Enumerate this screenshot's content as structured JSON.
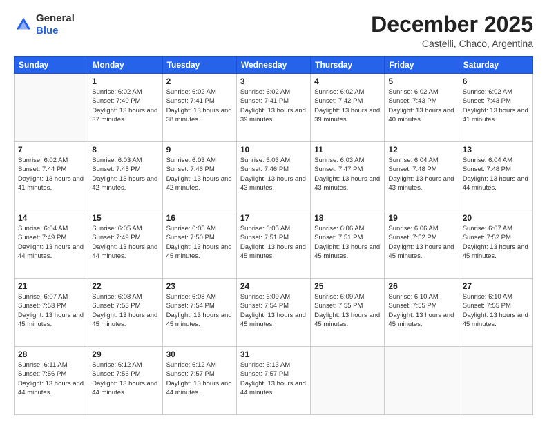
{
  "header": {
    "logo_general": "General",
    "logo_blue": "Blue",
    "month_title": "December 2025",
    "location": "Castelli, Chaco, Argentina"
  },
  "days_of_week": [
    "Sunday",
    "Monday",
    "Tuesday",
    "Wednesday",
    "Thursday",
    "Friday",
    "Saturday"
  ],
  "weeks": [
    [
      {
        "day": "",
        "sunrise": "",
        "sunset": "",
        "daylight": ""
      },
      {
        "day": "1",
        "sunrise": "Sunrise: 6:02 AM",
        "sunset": "Sunset: 7:40 PM",
        "daylight": "Daylight: 13 hours and 37 minutes."
      },
      {
        "day": "2",
        "sunrise": "Sunrise: 6:02 AM",
        "sunset": "Sunset: 7:41 PM",
        "daylight": "Daylight: 13 hours and 38 minutes."
      },
      {
        "day": "3",
        "sunrise": "Sunrise: 6:02 AM",
        "sunset": "Sunset: 7:41 PM",
        "daylight": "Daylight: 13 hours and 39 minutes."
      },
      {
        "day": "4",
        "sunrise": "Sunrise: 6:02 AM",
        "sunset": "Sunset: 7:42 PM",
        "daylight": "Daylight: 13 hours and 39 minutes."
      },
      {
        "day": "5",
        "sunrise": "Sunrise: 6:02 AM",
        "sunset": "Sunset: 7:43 PM",
        "daylight": "Daylight: 13 hours and 40 minutes."
      },
      {
        "day": "6",
        "sunrise": "Sunrise: 6:02 AM",
        "sunset": "Sunset: 7:43 PM",
        "daylight": "Daylight: 13 hours and 41 minutes."
      }
    ],
    [
      {
        "day": "7",
        "sunrise": "Sunrise: 6:02 AM",
        "sunset": "Sunset: 7:44 PM",
        "daylight": "Daylight: 13 hours and 41 minutes."
      },
      {
        "day": "8",
        "sunrise": "Sunrise: 6:03 AM",
        "sunset": "Sunset: 7:45 PM",
        "daylight": "Daylight: 13 hours and 42 minutes."
      },
      {
        "day": "9",
        "sunrise": "Sunrise: 6:03 AM",
        "sunset": "Sunset: 7:46 PM",
        "daylight": "Daylight: 13 hours and 42 minutes."
      },
      {
        "day": "10",
        "sunrise": "Sunrise: 6:03 AM",
        "sunset": "Sunset: 7:46 PM",
        "daylight": "Daylight: 13 hours and 43 minutes."
      },
      {
        "day": "11",
        "sunrise": "Sunrise: 6:03 AM",
        "sunset": "Sunset: 7:47 PM",
        "daylight": "Daylight: 13 hours and 43 minutes."
      },
      {
        "day": "12",
        "sunrise": "Sunrise: 6:04 AM",
        "sunset": "Sunset: 7:48 PM",
        "daylight": "Daylight: 13 hours and 43 minutes."
      },
      {
        "day": "13",
        "sunrise": "Sunrise: 6:04 AM",
        "sunset": "Sunset: 7:48 PM",
        "daylight": "Daylight: 13 hours and 44 minutes."
      }
    ],
    [
      {
        "day": "14",
        "sunrise": "Sunrise: 6:04 AM",
        "sunset": "Sunset: 7:49 PM",
        "daylight": "Daylight: 13 hours and 44 minutes."
      },
      {
        "day": "15",
        "sunrise": "Sunrise: 6:05 AM",
        "sunset": "Sunset: 7:49 PM",
        "daylight": "Daylight: 13 hours and 44 minutes."
      },
      {
        "day": "16",
        "sunrise": "Sunrise: 6:05 AM",
        "sunset": "Sunset: 7:50 PM",
        "daylight": "Daylight: 13 hours and 45 minutes."
      },
      {
        "day": "17",
        "sunrise": "Sunrise: 6:05 AM",
        "sunset": "Sunset: 7:51 PM",
        "daylight": "Daylight: 13 hours and 45 minutes."
      },
      {
        "day": "18",
        "sunrise": "Sunrise: 6:06 AM",
        "sunset": "Sunset: 7:51 PM",
        "daylight": "Daylight: 13 hours and 45 minutes."
      },
      {
        "day": "19",
        "sunrise": "Sunrise: 6:06 AM",
        "sunset": "Sunset: 7:52 PM",
        "daylight": "Daylight: 13 hours and 45 minutes."
      },
      {
        "day": "20",
        "sunrise": "Sunrise: 6:07 AM",
        "sunset": "Sunset: 7:52 PM",
        "daylight": "Daylight: 13 hours and 45 minutes."
      }
    ],
    [
      {
        "day": "21",
        "sunrise": "Sunrise: 6:07 AM",
        "sunset": "Sunset: 7:53 PM",
        "daylight": "Daylight: 13 hours and 45 minutes."
      },
      {
        "day": "22",
        "sunrise": "Sunrise: 6:08 AM",
        "sunset": "Sunset: 7:53 PM",
        "daylight": "Daylight: 13 hours and 45 minutes."
      },
      {
        "day": "23",
        "sunrise": "Sunrise: 6:08 AM",
        "sunset": "Sunset: 7:54 PM",
        "daylight": "Daylight: 13 hours and 45 minutes."
      },
      {
        "day": "24",
        "sunrise": "Sunrise: 6:09 AM",
        "sunset": "Sunset: 7:54 PM",
        "daylight": "Daylight: 13 hours and 45 minutes."
      },
      {
        "day": "25",
        "sunrise": "Sunrise: 6:09 AM",
        "sunset": "Sunset: 7:55 PM",
        "daylight": "Daylight: 13 hours and 45 minutes."
      },
      {
        "day": "26",
        "sunrise": "Sunrise: 6:10 AM",
        "sunset": "Sunset: 7:55 PM",
        "daylight": "Daylight: 13 hours and 45 minutes."
      },
      {
        "day": "27",
        "sunrise": "Sunrise: 6:10 AM",
        "sunset": "Sunset: 7:55 PM",
        "daylight": "Daylight: 13 hours and 45 minutes."
      }
    ],
    [
      {
        "day": "28",
        "sunrise": "Sunrise: 6:11 AM",
        "sunset": "Sunset: 7:56 PM",
        "daylight": "Daylight: 13 hours and 44 minutes."
      },
      {
        "day": "29",
        "sunrise": "Sunrise: 6:12 AM",
        "sunset": "Sunset: 7:56 PM",
        "daylight": "Daylight: 13 hours and 44 minutes."
      },
      {
        "day": "30",
        "sunrise": "Sunrise: 6:12 AM",
        "sunset": "Sunset: 7:57 PM",
        "daylight": "Daylight: 13 hours and 44 minutes."
      },
      {
        "day": "31",
        "sunrise": "Sunrise: 6:13 AM",
        "sunset": "Sunset: 7:57 PM",
        "daylight": "Daylight: 13 hours and 44 minutes."
      },
      {
        "day": "",
        "sunrise": "",
        "sunset": "",
        "daylight": ""
      },
      {
        "day": "",
        "sunrise": "",
        "sunset": "",
        "daylight": ""
      },
      {
        "day": "",
        "sunrise": "",
        "sunset": "",
        "daylight": ""
      }
    ]
  ]
}
